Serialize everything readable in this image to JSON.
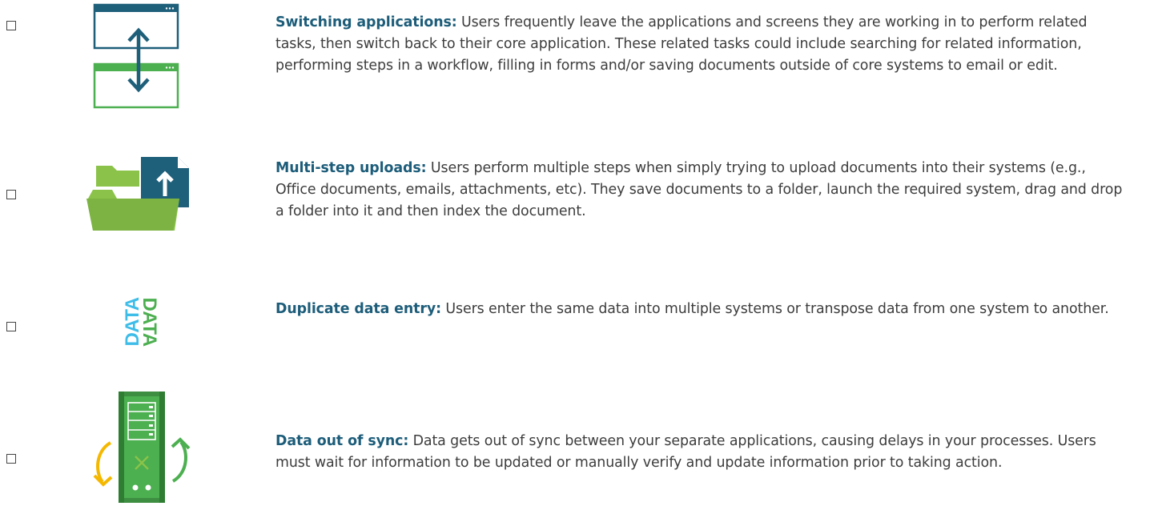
{
  "items": [
    {
      "title": "Switching applications:",
      "body": "Users frequently leave the applications and screens they are working in to perform related tasks, then switch back to their core application. These related tasks could include searching for related information, performing steps in a workflow, filling in forms and/or saving documents outside of core systems to email or edit.",
      "icon": "switching-windows-icon",
      "checked": false
    },
    {
      "title": "Multi-step uploads:",
      "body": "Users perform multiple steps when simply trying to upload documents into their systems (e.g., Office documents, emails, attachments, etc). They save documents to a folder, launch the required system, drag and drop a folder into it and then index the document.",
      "icon": "folder-upload-icon",
      "checked": false
    },
    {
      "title": "Duplicate data entry:",
      "body": "Users enter the same data into multiple systems or transpose data from one system to another.",
      "icon": "duplicate-data-icon",
      "icon_text_1": "DATA",
      "icon_text_2": "DATA",
      "checked": false
    },
    {
      "title": "Data out of sync:",
      "body": "Data gets out of sync between your separate applications, causing delays in your processes. Users must wait for information to be updated or manually verify and update information prior to taking action.",
      "icon": "server-sync-icon",
      "checked": false
    }
  ],
  "colors": {
    "navy": "#1d5d7a",
    "teal": "#1e6b80",
    "green": "#4caf50",
    "light_green": "#8bc34a",
    "cyan": "#3ebde8",
    "yellow": "#f5b800",
    "text": "#3d3d3d"
  }
}
